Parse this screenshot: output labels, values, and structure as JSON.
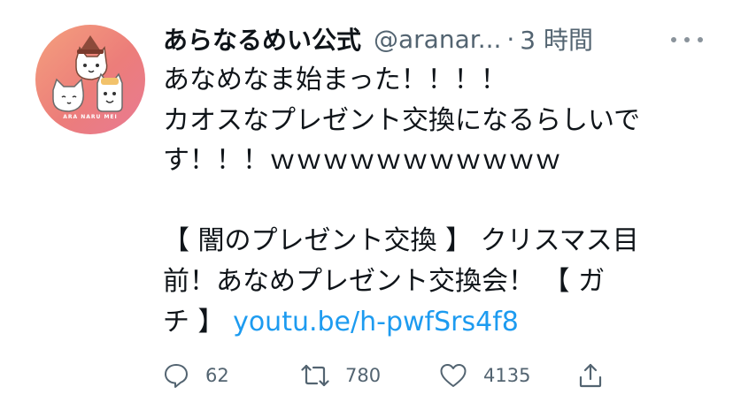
{
  "tweet": {
    "display_name": "あらなるめい公式",
    "handle": "@aranar...",
    "separator": "·",
    "timestamp": "3 時間",
    "avatar_text": "ARA NARU MEI",
    "text_lines": [
      "あなめなま始まった！！！！",
      "カオスなプレゼント交換になるらしいで",
      "す！！！ｗｗｗｗｗｗｗｗｗｗｗ",
      "",
      "【 闇のプレゼント交換 】 クリスマス目",
      "前！あなめプレゼント交換会！ 【 ガ",
      "チ 】 "
    ],
    "link_text": "youtu.be/h-pwfSrs4f8"
  },
  "actions": {
    "reply_count": "62",
    "retweet_count": "780",
    "like_count": "4135"
  },
  "colors": {
    "link": "#1d9bf0",
    "secondary_text": "#536471",
    "avatar_bg": "#ec7d7a"
  }
}
